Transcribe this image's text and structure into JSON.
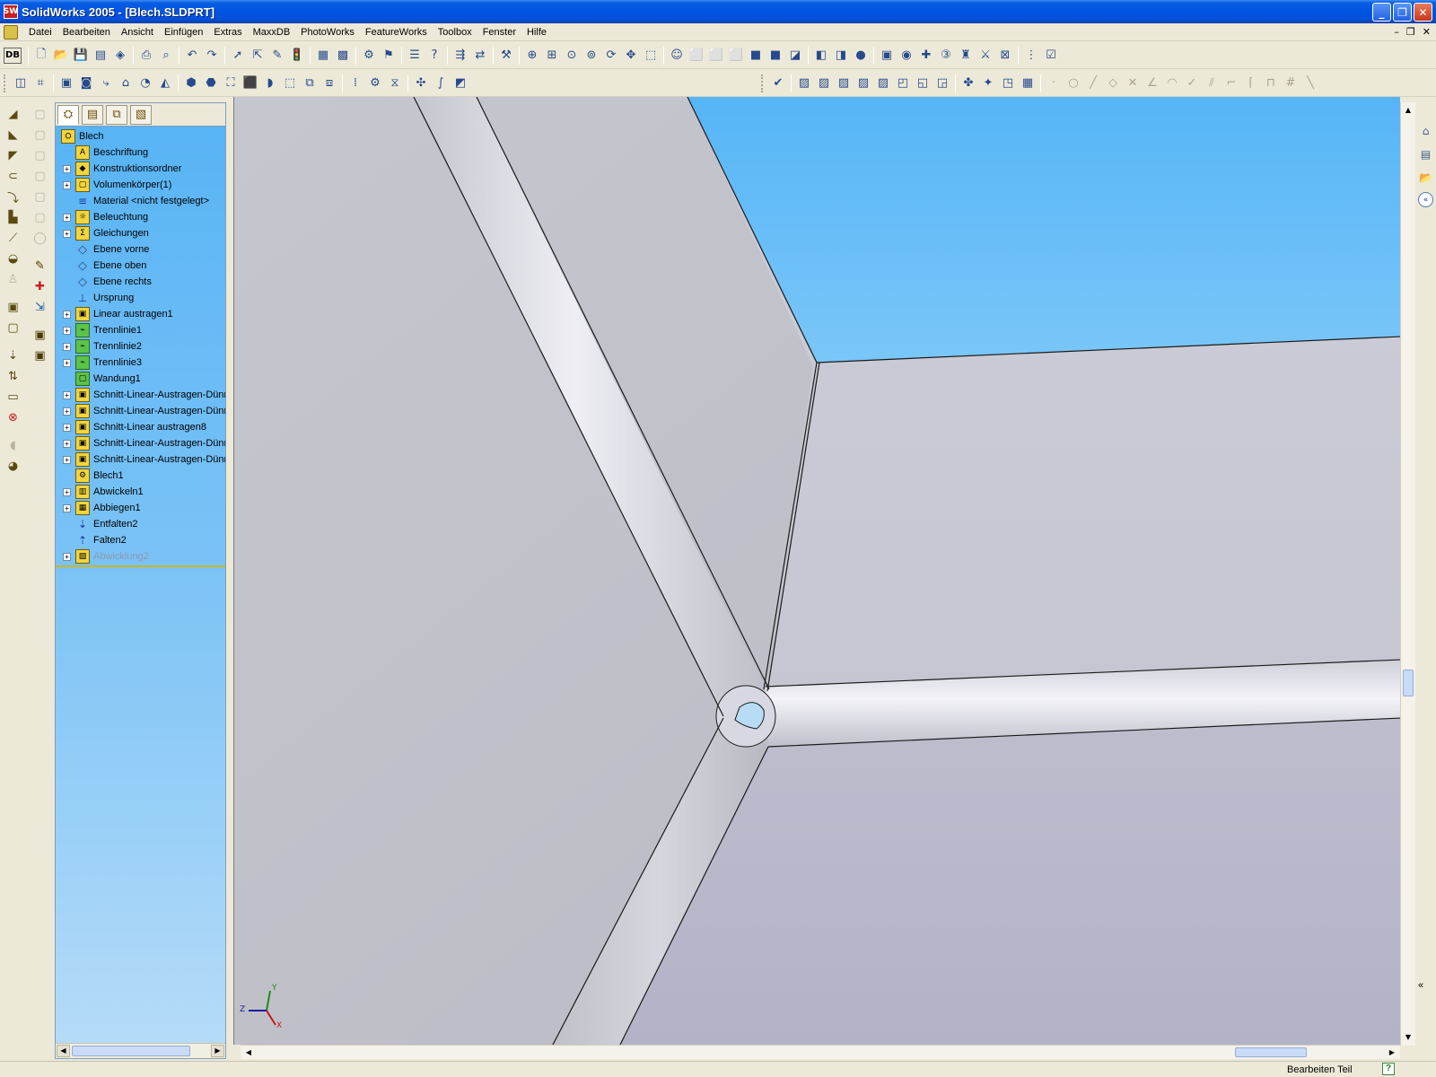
{
  "window": {
    "title": "SolidWorks 2005 - [Blech.SLDPRT]",
    "app_icon": "SW"
  },
  "menu": {
    "items": [
      "Datei",
      "Bearbeiten",
      "Ansicht",
      "Einfügen",
      "Extras",
      "MaxxDB",
      "PhotoWorks",
      "FeatureWorks",
      "Toolbox",
      "Fenster",
      "Hilfe"
    ]
  },
  "toolbar": {
    "db_label": "DB"
  },
  "feature_tree": {
    "root": "Blech",
    "items": [
      {
        "label": "Beschriftung",
        "icon": "annotation-icon",
        "expandable": false
      },
      {
        "label": "Konstruktionsordner",
        "icon": "design-binder-icon",
        "expandable": true
      },
      {
        "label": "Volumenkörper(1)",
        "icon": "solid-bodies-icon",
        "expandable": true
      },
      {
        "label": "Material <nicht festgelegt>",
        "icon": "material-icon",
        "expandable": false
      },
      {
        "label": "Beleuchtung",
        "icon": "lighting-icon",
        "expandable": true
      },
      {
        "label": "Gleichungen",
        "icon": "equations-icon",
        "expandable": true
      },
      {
        "label": "Ebene vorne",
        "icon": "plane-icon",
        "expandable": false
      },
      {
        "label": "Ebene oben",
        "icon": "plane-icon",
        "expandable": false
      },
      {
        "label": "Ebene rechts",
        "icon": "plane-icon",
        "expandable": false
      },
      {
        "label": "Ursprung",
        "icon": "origin-icon",
        "expandable": false
      },
      {
        "label": "Linear austragen1",
        "icon": "extrude-icon",
        "expandable": true
      },
      {
        "label": "Trennlinie1",
        "icon": "split-line-icon",
        "expandable": true
      },
      {
        "label": "Trennlinie2",
        "icon": "split-line-icon",
        "expandable": true
      },
      {
        "label": "Trennlinie3",
        "icon": "split-line-icon",
        "expandable": true
      },
      {
        "label": "Wandung1",
        "icon": "shell-icon",
        "expandable": false
      },
      {
        "label": "Schnitt-Linear-Austragen-Dünn",
        "icon": "cut-extrude-icon",
        "expandable": true
      },
      {
        "label": "Schnitt-Linear-Austragen-Dünn",
        "icon": "cut-extrude-icon",
        "expandable": true
      },
      {
        "label": "Schnitt-Linear austragen8",
        "icon": "cut-extrude-icon",
        "expandable": true
      },
      {
        "label": "Schnitt-Linear-Austragen-Dünn",
        "icon": "cut-extrude-icon",
        "expandable": true
      },
      {
        "label": "Schnitt-Linear-Austragen-Dünn",
        "icon": "cut-extrude-icon",
        "expandable": true
      },
      {
        "label": "Blech1",
        "icon": "sheet-metal-icon",
        "expandable": false
      },
      {
        "label": "Abwickeln1",
        "icon": "unfold-icon",
        "expandable": true
      },
      {
        "label": "Abbiegen1",
        "icon": "bend-icon",
        "expandable": true
      },
      {
        "label": "Entfalten2",
        "icon": "unfold-arrow-icon",
        "expandable": false
      },
      {
        "label": "Falten2",
        "icon": "fold-arrow-icon",
        "expandable": false
      },
      {
        "label": "Abwicklung2",
        "icon": "flat-pattern-icon",
        "expandable": true,
        "suppressed": true
      }
    ]
  },
  "triad": {
    "x": "X",
    "y": "Y",
    "z": "Z"
  },
  "status": {
    "text": "Bearbeiten Teil",
    "help": "?"
  },
  "colors": {
    "title_blue": "#0054e3",
    "tree_top": "#56b3f5",
    "viewport_bg": "#c5c6cf",
    "sky": "#5cb9f8"
  }
}
